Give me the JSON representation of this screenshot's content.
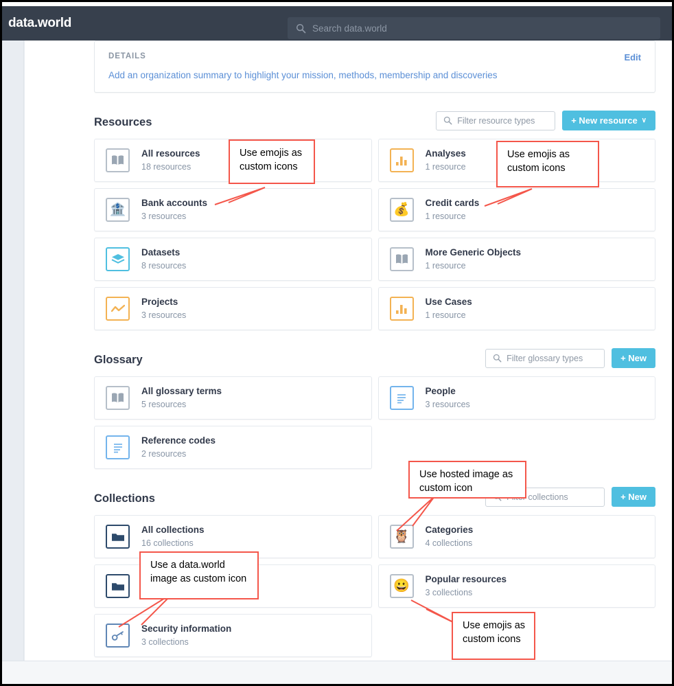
{
  "header": {
    "brand": "data.world",
    "search_placeholder": "Search data.world",
    "search_icon": "search-icon"
  },
  "details": {
    "label": "DETAILS",
    "edit_label": "Edit",
    "summary_link": "Add an organization summary to highlight your mission, methods, membership and discoveries"
  },
  "sections": [
    {
      "title": "Resources",
      "filter_placeholder": "Filter resource types",
      "new_button": "+ New resource",
      "new_button_has_chevron": true,
      "cards": [
        {
          "title": "All resources",
          "sub": "18 resources",
          "icon": "book-icon",
          "icon_style": "gray"
        },
        {
          "title": "Analyses",
          "sub": "1 resource",
          "icon": "bar-chart-icon",
          "icon_style": "orange"
        },
        {
          "title": "Bank accounts",
          "sub": "3 resources",
          "icon": "bank-emoji",
          "icon_style": "gray",
          "emoji": "🏦"
        },
        {
          "title": "Credit cards",
          "sub": "1 resource",
          "icon": "money-bag-emoji",
          "icon_style": "gray",
          "emoji": "💰"
        },
        {
          "title": "Datasets",
          "sub": "8 resources",
          "icon": "layers-icon",
          "icon_style": "cyan"
        },
        {
          "title": "More Generic Objects",
          "sub": "1 resource",
          "icon": "book-icon",
          "icon_style": "gray"
        },
        {
          "title": "Projects",
          "sub": "3 resources",
          "icon": "line-chart-icon",
          "icon_style": "orange"
        },
        {
          "title": "Use Cases",
          "sub": "1 resource",
          "icon": "bar-chart-icon",
          "icon_style": "orange"
        }
      ]
    },
    {
      "title": "Glossary",
      "filter_placeholder": "Filter glossary types",
      "new_button": "+ New",
      "new_button_has_chevron": false,
      "cards": [
        {
          "title": "All glossary terms",
          "sub": "5 resources",
          "icon": "book-icon",
          "icon_style": "gray"
        },
        {
          "title": "People",
          "sub": "3 resources",
          "icon": "document-icon",
          "icon_style": "blue"
        },
        {
          "title": "Reference codes",
          "sub": "2 resources",
          "icon": "document-icon",
          "icon_style": "blue"
        }
      ]
    },
    {
      "title": "Collections",
      "filter_placeholder": "Filter collections",
      "new_button": "+ New",
      "new_button_has_chevron": false,
      "cards": [
        {
          "title": "All collections",
          "sub": "16 collections",
          "icon": "folder-icon",
          "icon_style": "navy"
        },
        {
          "title": "Categories",
          "sub": "4 collections",
          "icon": "owl-image-icon",
          "icon_style": "gray",
          "emoji": "🦉"
        },
        {
          "title": "",
          "sub": "",
          "icon": "folder-icon",
          "icon_style": "navy"
        },
        {
          "title": "Popular resources",
          "sub": "3 collections",
          "icon": "grinning-face-emoji",
          "icon_style": "gray",
          "emoji": "😀"
        },
        {
          "title": "Security information",
          "sub": "3 collections",
          "icon": "key-icon",
          "icon_style": "steel"
        }
      ]
    }
  ],
  "annotations": [
    {
      "id": "a1",
      "text": "Use emojis as\ncustom icons"
    },
    {
      "id": "a2",
      "text": "Use emojis as\ncustom icons"
    },
    {
      "id": "a3",
      "text": "Use hosted image as\ncustom icon"
    },
    {
      "id": "a4",
      "text": "Use a data.world\nimage as custom icon"
    },
    {
      "id": "a5",
      "text": "Use emojis as\ncustom icons"
    }
  ],
  "colors": {
    "nav_background": "#37404d",
    "accent": "#4fbfe0",
    "link": "#5b8fd6",
    "annotation": "#f4564a"
  }
}
